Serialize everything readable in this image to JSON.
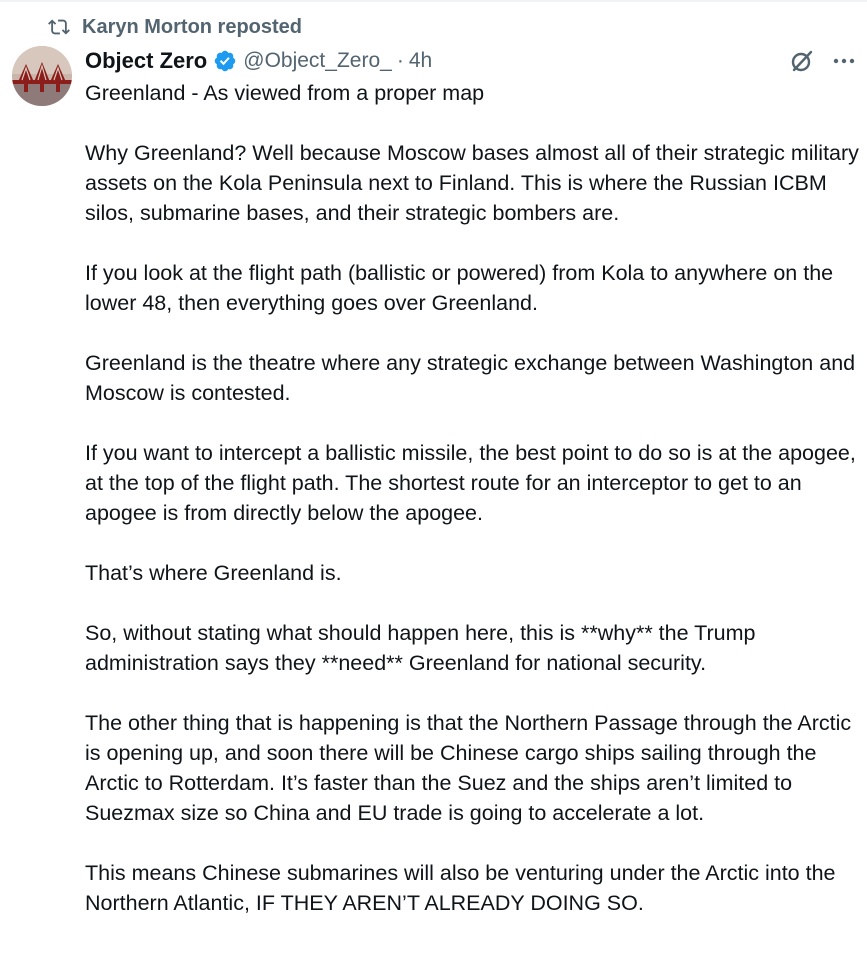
{
  "repost": {
    "icon": "repost-icon",
    "text": "Karyn Morton reposted"
  },
  "author": {
    "name": "Object Zero",
    "verified_icon": "verified-badge-icon",
    "handle": "@Object_Zero_",
    "separator": "·",
    "time": "4h",
    "avatar": "avatar-bridge-image"
  },
  "actions": {
    "grok_icon": "grok-icon",
    "more_icon": "more-icon"
  },
  "post": {
    "paragraphs": [
      "Greenland - As viewed from a proper map",
      "Why Greenland? Well because Moscow bases almost all of their strategic military assets on the Kola Peninsula next to Finland. This is where the Russian ICBM silos, submarine bases, and their strategic bombers are.",
      "If you look at the flight path (ballistic or powered) from Kola to anywhere on the lower 48, then everything goes over Greenland.",
      "Greenland is the theatre where any strategic exchange between Washington and Moscow is contested.",
      "If you want to intercept a ballistic missile, the best point to do so is at the apogee, at the top of the flight path. The shortest route for an interceptor to get to an apogee is from directly below the apogee.",
      "That’s where Greenland is.",
      "So, without stating what should happen here, this is **why** the Trump administration says they **need** Greenland for national security.",
      "The other thing that is happening is that the Northern Passage through the Arctic is opening up, and soon there will be Chinese cargo ships sailing through the Arctic to Rotterdam. It’s faster than the Suez and the ships aren’t limited to Suezmax size so China and EU trade is going to accelerate a lot.",
      "This means Chinese submarines will also be venturing under the Arctic into the Northern Atlantic, IF THEY AREN’T ALREADY DOING SO."
    ]
  },
  "colors": {
    "text": "#0f1419",
    "secondary": "#536471",
    "verified": "#1d9bf0"
  }
}
